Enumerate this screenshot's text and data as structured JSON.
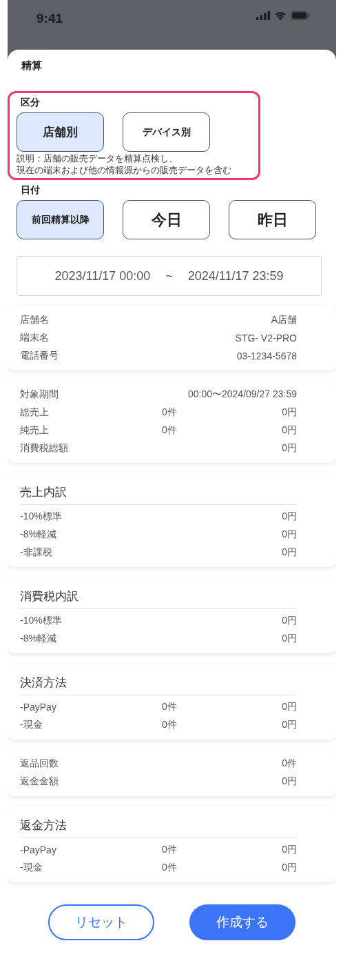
{
  "status_bar": {
    "time": "9:41"
  },
  "sheet": {
    "title": "精算"
  },
  "category": {
    "label": "区分",
    "highlighted": true,
    "options": [
      {
        "label": "店舗別",
        "selected": true
      },
      {
        "label": "デバイス別",
        "selected": false
      }
    ],
    "description_lines": [
      "説明：店舗の販売データを精算点検し、",
      "現在の端末および他の情報源からの販売データを含む"
    ]
  },
  "date": {
    "label": "日付",
    "options": [
      {
        "label": "前回精算以降",
        "selected": true
      },
      {
        "label": "今日",
        "selected": false
      },
      {
        "label": "昨日",
        "selected": false
      }
    ]
  },
  "date_range": {
    "start": "2023/11/17 00:00",
    "separator": "~",
    "end": "2024/11/17 23:59"
  },
  "cards": [
    {
      "rows": [
        {
          "label": "店舗名",
          "amount": "A店舗"
        },
        {
          "label": "端末名",
          "amount": "STG- V2-PRO"
        },
        {
          "label": "電話番号",
          "amount": "03-1234-5678"
        }
      ]
    },
    {
      "rows": [
        {
          "label": "対象期間",
          "amount": "00:00〜2024/09/27 23:59"
        },
        {
          "label": "総売上",
          "count": "0件",
          "amount": "0円"
        },
        {
          "label": "純売上",
          "count": "0件",
          "amount": "0円"
        },
        {
          "label": "消費税総額",
          "amount": "0円"
        }
      ]
    },
    {
      "title": "売上内訳",
      "rows": [
        {
          "label": "-10%標準",
          "amount": "0円"
        },
        {
          "label": "-8%軽減",
          "amount": "0円"
        },
        {
          "label": "-非課税",
          "amount": "0円"
        }
      ]
    },
    {
      "title": "消費税内訳",
      "rows": [
        {
          "label": "-10%標準",
          "amount": "0円"
        },
        {
          "label": "-8%軽減",
          "amount": "0円"
        }
      ]
    },
    {
      "title": "決済方法",
      "rows": [
        {
          "label": "-PayPay",
          "count": "0件",
          "amount": "0円"
        },
        {
          "label": "-現金",
          "count": "0件",
          "amount": "0円"
        }
      ]
    },
    {
      "rows": [
        {
          "label": "返品回数",
          "amount": "0件"
        },
        {
          "label": "返金金額",
          "amount": "0円"
        }
      ]
    },
    {
      "title": "返金方法",
      "rows": [
        {
          "label": "-PayPay",
          "count": "0件",
          "amount": "0円"
        },
        {
          "label": "-現金",
          "count": "0件",
          "amount": "0円"
        }
      ]
    }
  ],
  "actions": [
    {
      "label": "リセット",
      "kind": "secondary"
    },
    {
      "label": "作成する",
      "kind": "primary"
    }
  ]
}
